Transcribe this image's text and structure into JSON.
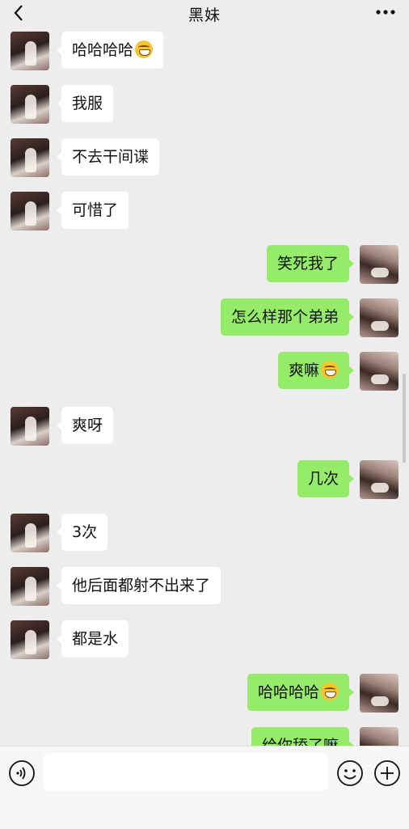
{
  "header": {
    "title": "黑妹"
  },
  "messages": [
    {
      "side": "left",
      "text": "哈哈哈哈",
      "emoji": "laugh-cry-emoji"
    },
    {
      "side": "left",
      "text": "我服"
    },
    {
      "side": "left",
      "text": "不去干间谍"
    },
    {
      "side": "left",
      "text": "可惜了"
    },
    {
      "side": "right",
      "text": "笑死我了"
    },
    {
      "side": "right",
      "text": "怎么样那个弟弟"
    },
    {
      "side": "right",
      "text": "爽嘛",
      "emoji": "grin-emoji"
    },
    {
      "side": "left",
      "text": "爽呀"
    },
    {
      "side": "right",
      "text": "几次"
    },
    {
      "side": "left",
      "text": "3次"
    },
    {
      "side": "left",
      "text": "他后面都射不出来了"
    },
    {
      "side": "left",
      "text": "都是水"
    },
    {
      "side": "right",
      "text": "哈哈哈哈",
      "emoji": "laugh-cry-emoji"
    },
    {
      "side": "right",
      "text": "给你舔了嘛"
    }
  ],
  "input": {
    "value": ""
  },
  "colors": {
    "background": "#ededed",
    "sent_bubble": "#95ec69",
    "received_bubble": "#ffffff"
  },
  "icons": [
    "back-arrow-icon",
    "more-dots-icon",
    "voice-icon",
    "emoji-icon",
    "plus-icon"
  ]
}
